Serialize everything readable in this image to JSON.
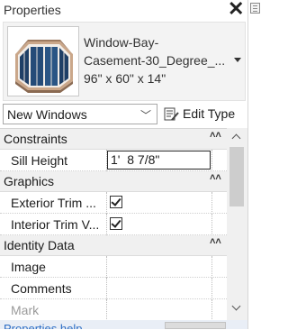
{
  "panel": {
    "title": "Properties"
  },
  "type_selector": {
    "icon": "bay-window-thumbnail",
    "lines": [
      "Window-Bay-",
      "Casement-30_Degree_...",
      "96\" x 60\" x 14\""
    ]
  },
  "family": {
    "selected": "New Windows",
    "edit_type_label": "Edit Type"
  },
  "groups": {
    "constraints": "Constraints",
    "graphics": "Graphics",
    "identity": "Identity Data"
  },
  "properties": {
    "sill_height": {
      "label": "Sill Height",
      "value": "1'  8 7/8\""
    },
    "exterior_trim": {
      "label": "Exterior Trim ...",
      "checked": true
    },
    "interior_trim": {
      "label": "Interior Trim V...",
      "checked": true
    },
    "image": {
      "label": "Image",
      "value": ""
    },
    "comments": {
      "label": "Comments",
      "value": ""
    },
    "mark": {
      "label": "Mark",
      "value": ""
    }
  },
  "footer": {
    "link": "Properties help"
  }
}
